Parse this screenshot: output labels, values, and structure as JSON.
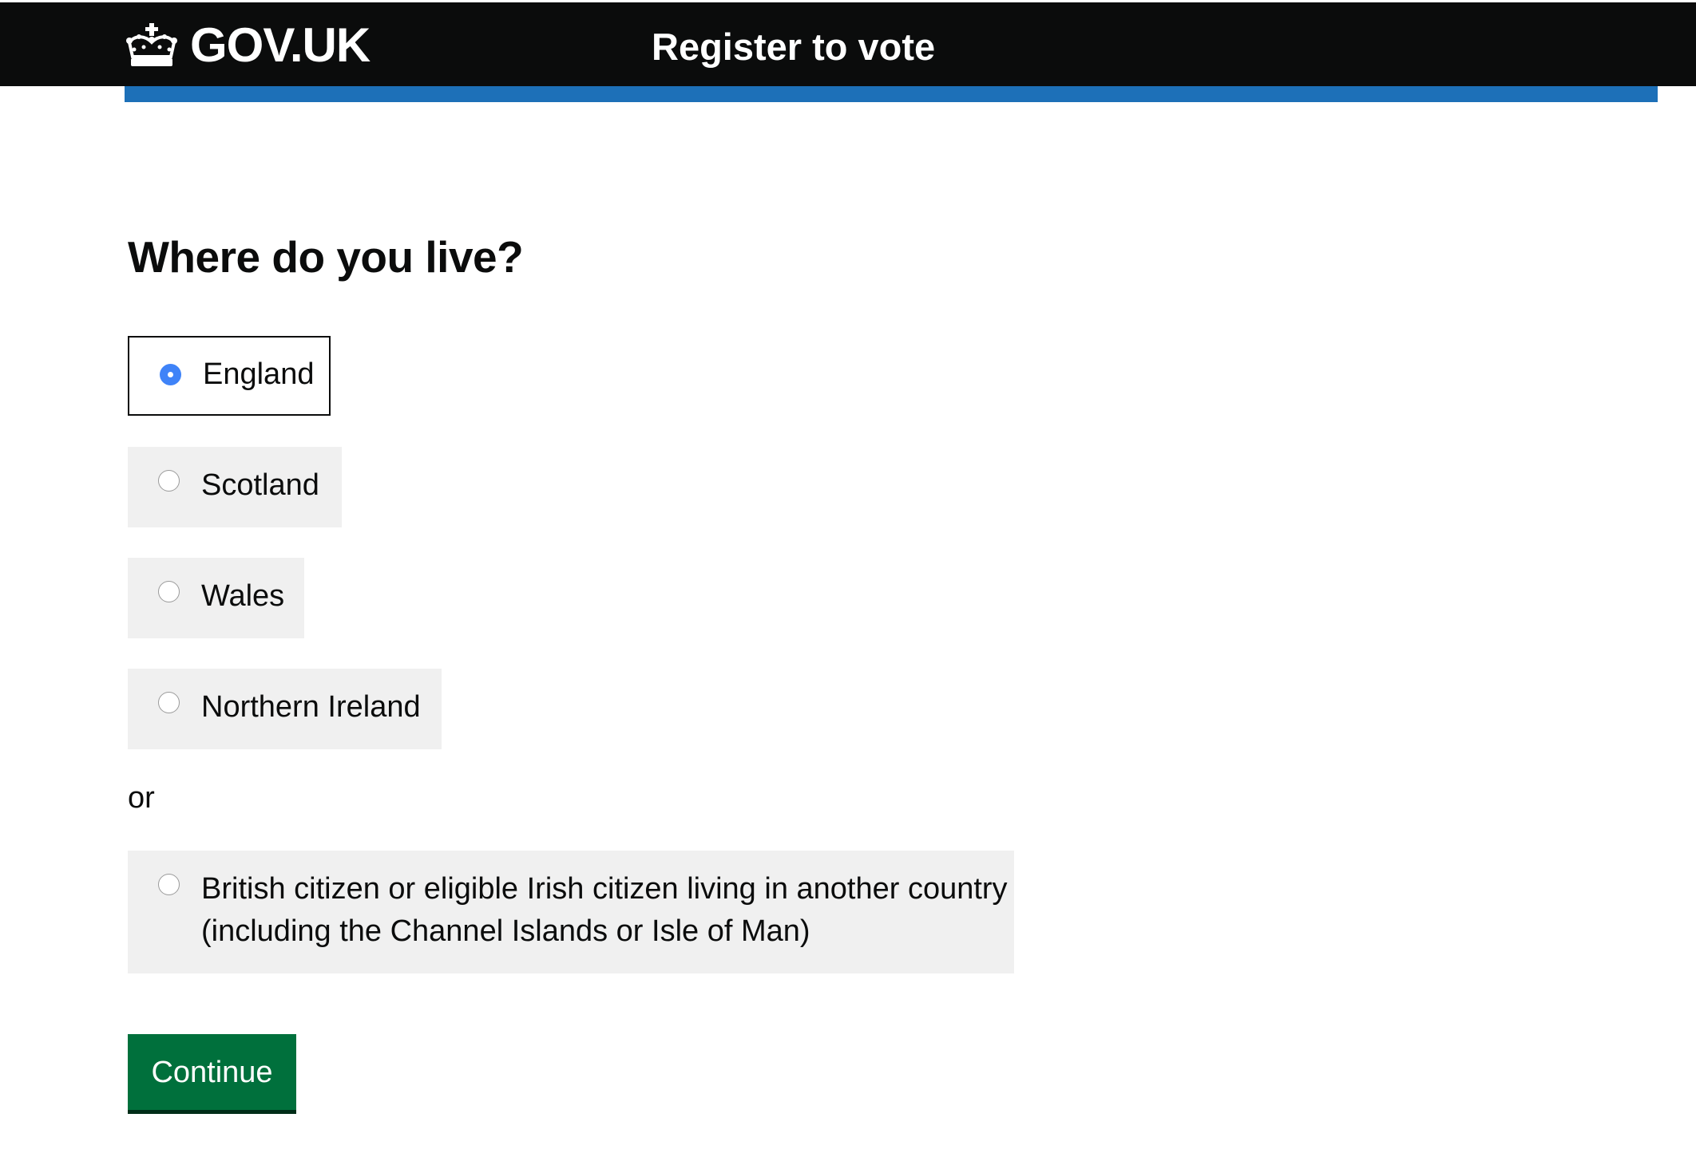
{
  "header": {
    "logo_text": "GOV.UK",
    "logo_icon": "crown-icon",
    "service_name": "Register to vote",
    "colors": {
      "header_background": "#0b0c0c",
      "accent_bar": "#1d70b8"
    }
  },
  "main": {
    "title": "Where do you live?",
    "options": [
      {
        "label": "England",
        "checked": true
      },
      {
        "label": "Scotland",
        "checked": false
      },
      {
        "label": "Wales",
        "checked": false
      },
      {
        "label": "Northern Ireland",
        "checked": false
      }
    ],
    "divider_text": "or",
    "other_option": {
      "label_line1": "British citizen or eligible Irish citizen living in another country",
      "label_line2": "(including the Channel Islands or Isle of Man)",
      "checked": false
    },
    "continue_label": "Continue",
    "colors": {
      "button": "#00703c",
      "option_background": "#f0f0f0",
      "radio_checked": "#3f83f8"
    }
  }
}
